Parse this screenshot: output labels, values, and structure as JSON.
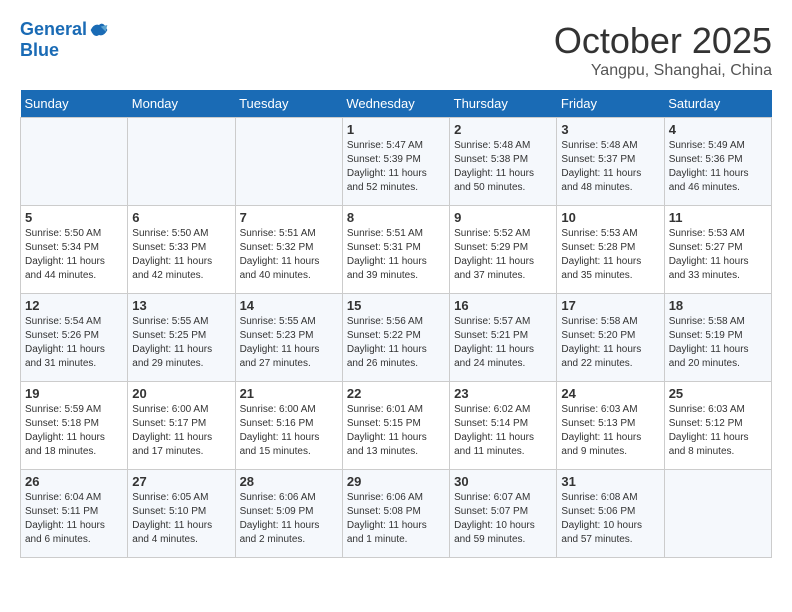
{
  "header": {
    "logo_line1": "General",
    "logo_line2": "Blue",
    "month": "October 2025",
    "location": "Yangpu, Shanghai, China"
  },
  "days_of_week": [
    "Sunday",
    "Monday",
    "Tuesday",
    "Wednesday",
    "Thursday",
    "Friday",
    "Saturday"
  ],
  "weeks": [
    [
      {
        "day": "",
        "info": ""
      },
      {
        "day": "",
        "info": ""
      },
      {
        "day": "",
        "info": ""
      },
      {
        "day": "1",
        "info": "Sunrise: 5:47 AM\nSunset: 5:39 PM\nDaylight: 11 hours\nand 52 minutes."
      },
      {
        "day": "2",
        "info": "Sunrise: 5:48 AM\nSunset: 5:38 PM\nDaylight: 11 hours\nand 50 minutes."
      },
      {
        "day": "3",
        "info": "Sunrise: 5:48 AM\nSunset: 5:37 PM\nDaylight: 11 hours\nand 48 minutes."
      },
      {
        "day": "4",
        "info": "Sunrise: 5:49 AM\nSunset: 5:36 PM\nDaylight: 11 hours\nand 46 minutes."
      }
    ],
    [
      {
        "day": "5",
        "info": "Sunrise: 5:50 AM\nSunset: 5:34 PM\nDaylight: 11 hours\nand 44 minutes."
      },
      {
        "day": "6",
        "info": "Sunrise: 5:50 AM\nSunset: 5:33 PM\nDaylight: 11 hours\nand 42 minutes."
      },
      {
        "day": "7",
        "info": "Sunrise: 5:51 AM\nSunset: 5:32 PM\nDaylight: 11 hours\nand 40 minutes."
      },
      {
        "day": "8",
        "info": "Sunrise: 5:51 AM\nSunset: 5:31 PM\nDaylight: 11 hours\nand 39 minutes."
      },
      {
        "day": "9",
        "info": "Sunrise: 5:52 AM\nSunset: 5:29 PM\nDaylight: 11 hours\nand 37 minutes."
      },
      {
        "day": "10",
        "info": "Sunrise: 5:53 AM\nSunset: 5:28 PM\nDaylight: 11 hours\nand 35 minutes."
      },
      {
        "day": "11",
        "info": "Sunrise: 5:53 AM\nSunset: 5:27 PM\nDaylight: 11 hours\nand 33 minutes."
      }
    ],
    [
      {
        "day": "12",
        "info": "Sunrise: 5:54 AM\nSunset: 5:26 PM\nDaylight: 11 hours\nand 31 minutes."
      },
      {
        "day": "13",
        "info": "Sunrise: 5:55 AM\nSunset: 5:25 PM\nDaylight: 11 hours\nand 29 minutes."
      },
      {
        "day": "14",
        "info": "Sunrise: 5:55 AM\nSunset: 5:23 PM\nDaylight: 11 hours\nand 27 minutes."
      },
      {
        "day": "15",
        "info": "Sunrise: 5:56 AM\nSunset: 5:22 PM\nDaylight: 11 hours\nand 26 minutes."
      },
      {
        "day": "16",
        "info": "Sunrise: 5:57 AM\nSunset: 5:21 PM\nDaylight: 11 hours\nand 24 minutes."
      },
      {
        "day": "17",
        "info": "Sunrise: 5:58 AM\nSunset: 5:20 PM\nDaylight: 11 hours\nand 22 minutes."
      },
      {
        "day": "18",
        "info": "Sunrise: 5:58 AM\nSunset: 5:19 PM\nDaylight: 11 hours\nand 20 minutes."
      }
    ],
    [
      {
        "day": "19",
        "info": "Sunrise: 5:59 AM\nSunset: 5:18 PM\nDaylight: 11 hours\nand 18 minutes."
      },
      {
        "day": "20",
        "info": "Sunrise: 6:00 AM\nSunset: 5:17 PM\nDaylight: 11 hours\nand 17 minutes."
      },
      {
        "day": "21",
        "info": "Sunrise: 6:00 AM\nSunset: 5:16 PM\nDaylight: 11 hours\nand 15 minutes."
      },
      {
        "day": "22",
        "info": "Sunrise: 6:01 AM\nSunset: 5:15 PM\nDaylight: 11 hours\nand 13 minutes."
      },
      {
        "day": "23",
        "info": "Sunrise: 6:02 AM\nSunset: 5:14 PM\nDaylight: 11 hours\nand 11 minutes."
      },
      {
        "day": "24",
        "info": "Sunrise: 6:03 AM\nSunset: 5:13 PM\nDaylight: 11 hours\nand 9 minutes."
      },
      {
        "day": "25",
        "info": "Sunrise: 6:03 AM\nSunset: 5:12 PM\nDaylight: 11 hours\nand 8 minutes."
      }
    ],
    [
      {
        "day": "26",
        "info": "Sunrise: 6:04 AM\nSunset: 5:11 PM\nDaylight: 11 hours\nand 6 minutes."
      },
      {
        "day": "27",
        "info": "Sunrise: 6:05 AM\nSunset: 5:10 PM\nDaylight: 11 hours\nand 4 minutes."
      },
      {
        "day": "28",
        "info": "Sunrise: 6:06 AM\nSunset: 5:09 PM\nDaylight: 11 hours\nand 2 minutes."
      },
      {
        "day": "29",
        "info": "Sunrise: 6:06 AM\nSunset: 5:08 PM\nDaylight: 11 hours\nand 1 minute."
      },
      {
        "day": "30",
        "info": "Sunrise: 6:07 AM\nSunset: 5:07 PM\nDaylight: 10 hours\nand 59 minutes."
      },
      {
        "day": "31",
        "info": "Sunrise: 6:08 AM\nSunset: 5:06 PM\nDaylight: 10 hours\nand 57 minutes."
      },
      {
        "day": "",
        "info": ""
      }
    ]
  ]
}
